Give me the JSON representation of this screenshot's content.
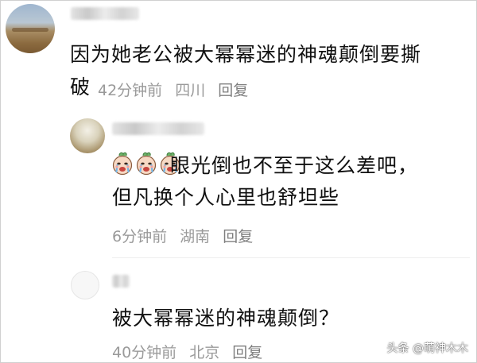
{
  "comments": [
    {
      "text_line1": "因为她老公被大幂幂迷的神魂颠倒要撕",
      "text_line2": "破",
      "time": "42分钟前",
      "location": "四川",
      "reply_label": "回复"
    },
    {
      "emoji_name": "crying-baby-face-icon",
      "text_line1": "眼光倒也不至于这么差吧，",
      "text_line2": "但凡换个人心里也舒坦些",
      "time": "6分钟前",
      "location": "湖南",
      "reply_label": "回复"
    },
    {
      "text": "被大幂幂迷的神魂颠倒？",
      "time": "40分钟前",
      "location": "北京",
      "reply_label": "回复"
    }
  ],
  "watermark": "头条 @萌神木木"
}
